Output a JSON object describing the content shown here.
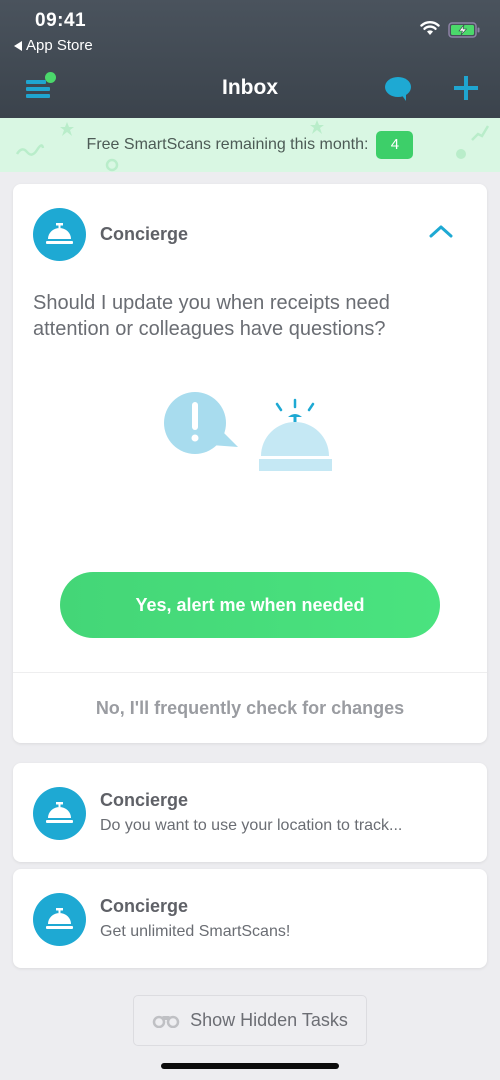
{
  "status_bar": {
    "time": "09:41",
    "back_app": "App Store",
    "icons": [
      "wifi-icon",
      "battery-charging-icon"
    ]
  },
  "nav": {
    "title": "Inbox",
    "menu_icon": "menu-icon",
    "notification_dot": true,
    "chat_icon": "chat-bubble-icon",
    "add_icon": "plus-icon"
  },
  "promo": {
    "text": "Free SmartScans remaining this month:",
    "count": "4"
  },
  "main_card": {
    "sender": "Concierge",
    "avatar_icon": "concierge-bell-icon",
    "collapse_icon": "chevron-up-icon",
    "question": "Should I update you when receipts need attention or colleagues have questions?",
    "illustration": [
      "alert-bubble-icon",
      "ringing-bell-icon"
    ],
    "yes_label": "Yes, alert me when needed",
    "no_label": "No, I'll frequently check for changes"
  },
  "tasks": [
    {
      "sender": "Concierge",
      "preview": "Do you want to use your location to track..."
    },
    {
      "sender": "Concierge",
      "preview": "Get unlimited SmartScans!"
    }
  ],
  "show_hidden": {
    "label": "Show Hidden Tasks",
    "icon": "binoculars-icon"
  },
  "colors": {
    "accent_blue": "#1ea9d3",
    "accent_green": "#44d677",
    "header_bg": "#434b55",
    "promo_bg": "#d9f7e3"
  }
}
